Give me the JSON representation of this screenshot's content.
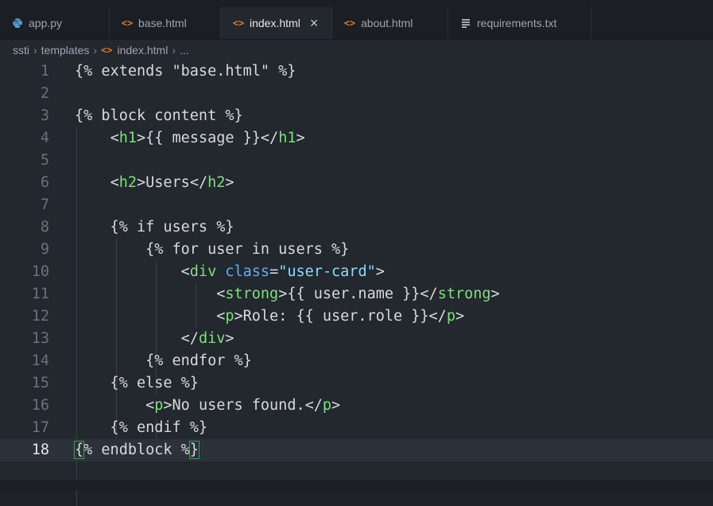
{
  "tabs": [
    {
      "label": "app.py",
      "icon": "python-icon",
      "active": false
    },
    {
      "label": "base.html",
      "icon": "html-icon",
      "active": false
    },
    {
      "label": "index.html",
      "icon": "html-icon",
      "active": true
    },
    {
      "label": "about.html",
      "icon": "html-icon",
      "active": false
    },
    {
      "label": "requirements.txt",
      "icon": "text-file-icon",
      "active": false
    }
  ],
  "breadcrumb": {
    "folder1": "ssti",
    "folder2": "templates",
    "file": "index.html",
    "more": "..."
  },
  "editor": {
    "current_line": 18,
    "lines": [
      {
        "n": "1",
        "text": "{% extends \"base.html\" %}"
      },
      {
        "n": "2",
        "text": ""
      },
      {
        "n": "3",
        "text": "{% block content %}"
      },
      {
        "n": "4",
        "text": "    <h1>{{ message }}</h1>"
      },
      {
        "n": "5",
        "text": ""
      },
      {
        "n": "6",
        "text": "    <h2>Users</h2>"
      },
      {
        "n": "7",
        "text": ""
      },
      {
        "n": "8",
        "text": "    {% if users %}"
      },
      {
        "n": "9",
        "text": "        {% for user in users %}"
      },
      {
        "n": "10",
        "text": "            <div class=\"user-card\">"
      },
      {
        "n": "11",
        "text": "                <strong>{{ user.name }}</strong>"
      },
      {
        "n": "12",
        "text": "                <p>Role: {{ user.role }}</p>"
      },
      {
        "n": "13",
        "text": "            </div>"
      },
      {
        "n": "14",
        "text": "        {% endfor %}"
      },
      {
        "n": "15",
        "text": "    {% else %}"
      },
      {
        "n": "16",
        "text": "        <p>No users found.</p>"
      },
      {
        "n": "17",
        "text": "    {% endif %}"
      },
      {
        "n": "18",
        "text": "{% endblock %}"
      }
    ]
  },
  "colors": {
    "background": "#23272e",
    "tag": "#7ee07e",
    "attribute": "#61afef",
    "string": "#89ddff",
    "text": "#d7dae0",
    "html_icon": "#e37933",
    "python_icon": "#4b8bbe"
  }
}
